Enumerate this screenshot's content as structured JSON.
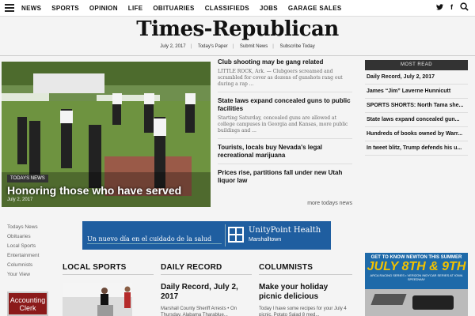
{
  "nav": {
    "items": [
      "NEWS",
      "SPORTS",
      "OPINION",
      "LIFE",
      "OBITUARIES",
      "CLASSIFIEDS",
      "JOBS",
      "GARAGE SALES"
    ],
    "social": {
      "twitter": "twitter-icon",
      "facebook": "facebook-icon",
      "search": "search-icon"
    }
  },
  "masthead": {
    "title": "Times-Republican",
    "date": "July 2, 2017",
    "links": [
      "Today's Paper",
      "Submit News",
      "Subscribe Today"
    ]
  },
  "hero": {
    "tag": "TODAYS NEWS",
    "title": "Honoring those who have served",
    "date": "July 2, 2017"
  },
  "stories": [
    {
      "title": "Club shooting may be gang related",
      "snippet": "LITTLE ROCK, Ark. — Clubgoers screamed and scrambled for cover as dozens of gunshots rang out during a rap ..."
    },
    {
      "title": "State laws expand concealed guns to public facilities",
      "snippet": "Starting Saturday, concealed guns are allowed at college campuses in Georgia and Kansas, more public buildings and ..."
    },
    {
      "title": "Tourists, locals buy Nevada's legal recreational marijuana",
      "snippet": ""
    },
    {
      "title": "Prices rise, partitions fall under new Utah liquor law",
      "snippet": ""
    }
  ],
  "more_news": "more todays news",
  "most_read": {
    "heading": "MOST READ",
    "items": [
      "Daily Record, July 2, 2017",
      "James “Jim” Laverne Hunnicutt",
      "SPORTS SHORTS: North Tama she...",
      "State laws expand concealed gun...",
      "Hundreds of books owned by Warr...",
      "In tweet blitz, Trump defends his u..."
    ]
  },
  "left_links": [
    "Todays News",
    "Obituaries",
    "Local Sports",
    "Entertainment",
    "Columnists",
    "Your View"
  ],
  "banner": {
    "left_text": "Un nuevo día en el cuidado de la salud",
    "brand": "UnityPoint Health",
    "sub": "Marshalltown",
    "brand_color": "#1f5ea0"
  },
  "sections": [
    {
      "title": "LOCAL SPORTS",
      "headline": "",
      "snippet": ""
    },
    {
      "title": "DAILY RECORD",
      "headline": "Daily Record, July 2, 2017",
      "snippet": "Marshall County Sheriff Arrests • On Thursday, Alabama Tharablue..."
    },
    {
      "title": "COLUMNISTS",
      "headline": "Make your holiday picnic delicious",
      "snippet": "Today I have some recipes for your July 4 picnic. Potato Salad 8 med..."
    }
  ],
  "ads": {
    "accounting": "Accounting Clerk",
    "newton_top": "GET TO KNOW NEWTON THIS SUMMER",
    "newton_date": "JULY 8TH & 9TH",
    "newton_small": "ARCA RACING SERIES • VERIZON INDYCAR SERIES AT IOWA SPEEDWAY"
  }
}
